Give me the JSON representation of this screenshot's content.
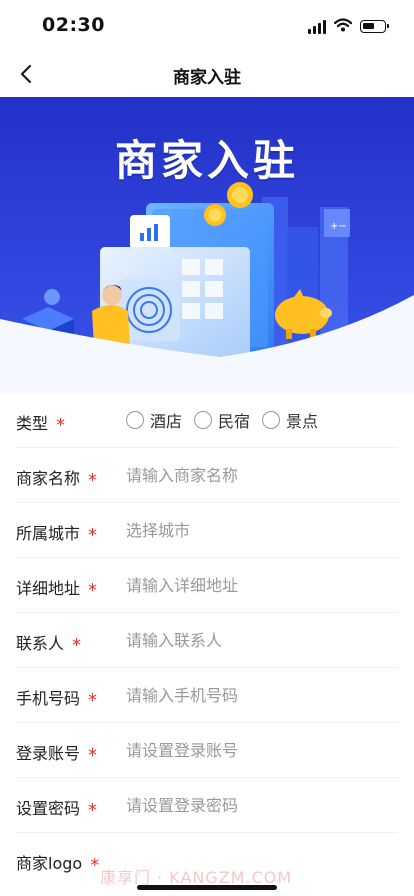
{
  "status_bar": {
    "time": "02:30"
  },
  "nav": {
    "title": "商家入驻"
  },
  "banner": {
    "title": "商家入驻"
  },
  "form": {
    "type_label": "类型",
    "type_options": [
      "酒店",
      "民宿",
      "景点"
    ],
    "fields": [
      {
        "key": "merchant_name",
        "label": "商家名称",
        "placeholder": "请输入商家名称"
      },
      {
        "key": "city",
        "label": "所属城市",
        "placeholder": "选择城市"
      },
      {
        "key": "address",
        "label": "详细地址",
        "placeholder": "请输入详细地址"
      },
      {
        "key": "contact",
        "label": "联系人",
        "placeholder": "请输入联系人"
      },
      {
        "key": "phone",
        "label": "手机号码",
        "placeholder": "请输入手机号码"
      },
      {
        "key": "account",
        "label": "登录账号",
        "placeholder": "请设置登录账号"
      },
      {
        "key": "password",
        "label": "设置密码",
        "placeholder": "请设置登录密码"
      }
    ],
    "logo_label": "商家logo",
    "required_mark": "*"
  },
  "watermark": "康享门 · KANGZM.COM",
  "colors": {
    "banner_bg": "#2a3bd6",
    "required": "#e8322e",
    "placeholder": "#999999"
  }
}
